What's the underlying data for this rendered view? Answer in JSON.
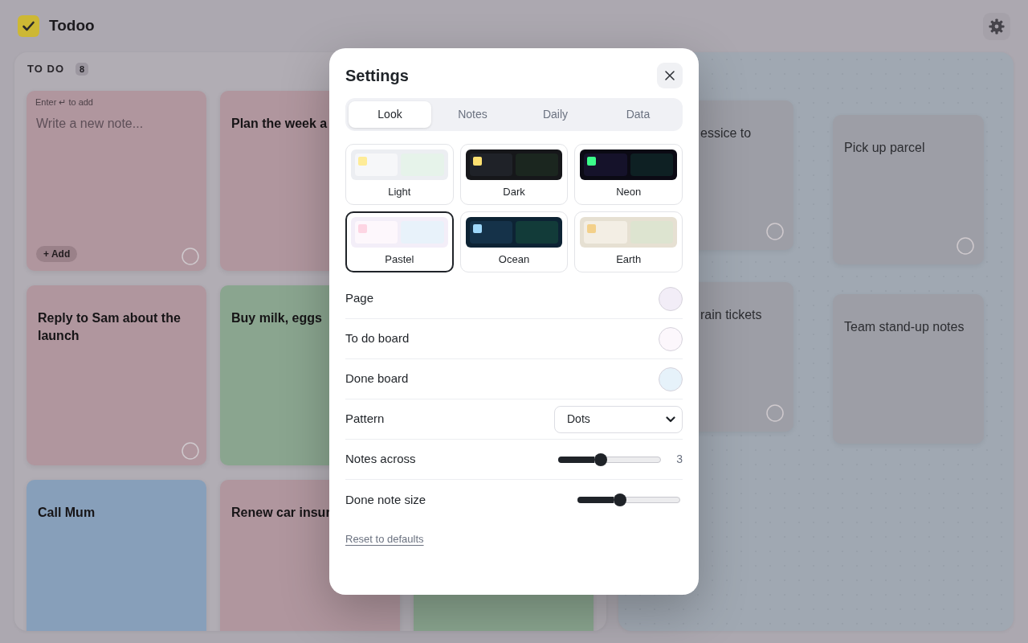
{
  "app": {
    "title": "Todoo"
  },
  "todo_board": {
    "title": "TO DO",
    "count": "8",
    "composer": {
      "hint": "Enter ↵ to add",
      "placeholder": "Write a new note...",
      "add_button": "+ Add",
      "color": "#b0969e"
    },
    "notes": [
      {
        "text": "Plan the week a",
        "color": "#b0969e"
      },
      {
        "text": "Reply to Sam about the launch",
        "color": "#b0969e"
      },
      {
        "text": "Buy milk, eggs",
        "color": "#8aa58f"
      },
      {
        "text": "Call Mum",
        "color": "#879fba"
      },
      {
        "text": "Renew car insur",
        "color": "#b0969e"
      },
      {
        "color": "#8aa58f"
      }
    ]
  },
  "done_board": {
    "notes": [
      {
        "text": "essice to"
      },
      {
        "text": "Pick up parcel"
      },
      {
        "text": "rain tickets"
      },
      {
        "text": "Team stand-up notes"
      }
    ]
  },
  "settings": {
    "title": "Settings",
    "tabs": [
      {
        "label": "Look",
        "selected": true
      },
      {
        "label": "Notes",
        "selected": false
      },
      {
        "label": "Daily",
        "selected": false
      },
      {
        "label": "Data",
        "selected": false
      }
    ],
    "themes": [
      {
        "label": "Light",
        "selected": false,
        "color": "#eceef2",
        "boards": [
          {
            "color": "#f6f7f9",
            "notes": [
              {
                "color": "#feec98"
              }
            ]
          },
          {
            "color": "#e6f3ea"
          }
        ]
      },
      {
        "label": "Dark",
        "selected": false,
        "color": "#16171a",
        "boards": [
          {
            "color": "#1f2228",
            "notes": [
              {
                "color": "#fde070"
              }
            ]
          },
          {
            "color": "#1b261f"
          }
        ]
      },
      {
        "label": "Neon",
        "selected": false,
        "color": "#0b0a14",
        "boards": [
          {
            "color": "#15122a",
            "notes": [
              {
                "color": "#3cfc8a"
              }
            ]
          },
          {
            "color": "#0e2023"
          }
        ]
      },
      {
        "label": "Pastel",
        "selected": true,
        "color": "#f3eef8",
        "boards": [
          {
            "color": "#fdf7fc",
            "notes": [
              {
                "color": "#fdd5e3"
              }
            ]
          },
          {
            "color": "#e8f2fa"
          }
        ]
      },
      {
        "label": "Ocean",
        "selected": false,
        "color": "#0d2334",
        "boards": [
          {
            "color": "#153249",
            "notes": [
              {
                "color": "#9fd8fb"
              }
            ]
          },
          {
            "color": "#123b39"
          }
        ]
      },
      {
        "label": "Earth",
        "selected": false,
        "color": "#e6e0d2",
        "boards": [
          {
            "color": "#f3eee4",
            "notes": [
              {
                "color": "#f3d08a"
              }
            ]
          },
          {
            "color": "#dde4d0"
          }
        ]
      }
    ],
    "rows": [
      {
        "kind": "color",
        "label": "Page",
        "color": "#f2edf7"
      },
      {
        "kind": "color",
        "label": "To do board",
        "color": "#fcf7fc"
      },
      {
        "kind": "color",
        "label": "Done board",
        "color": "#e6f2fa"
      },
      {
        "kind": "select",
        "label": "Pattern",
        "value": "Dots"
      },
      {
        "kind": "slider",
        "label": "Notes across",
        "level": 0.4,
        "reading": "3"
      },
      {
        "kind": "slider",
        "label": "Done note size",
        "level": 0.4
      }
    ],
    "reset_link": "Reset to defaults"
  }
}
